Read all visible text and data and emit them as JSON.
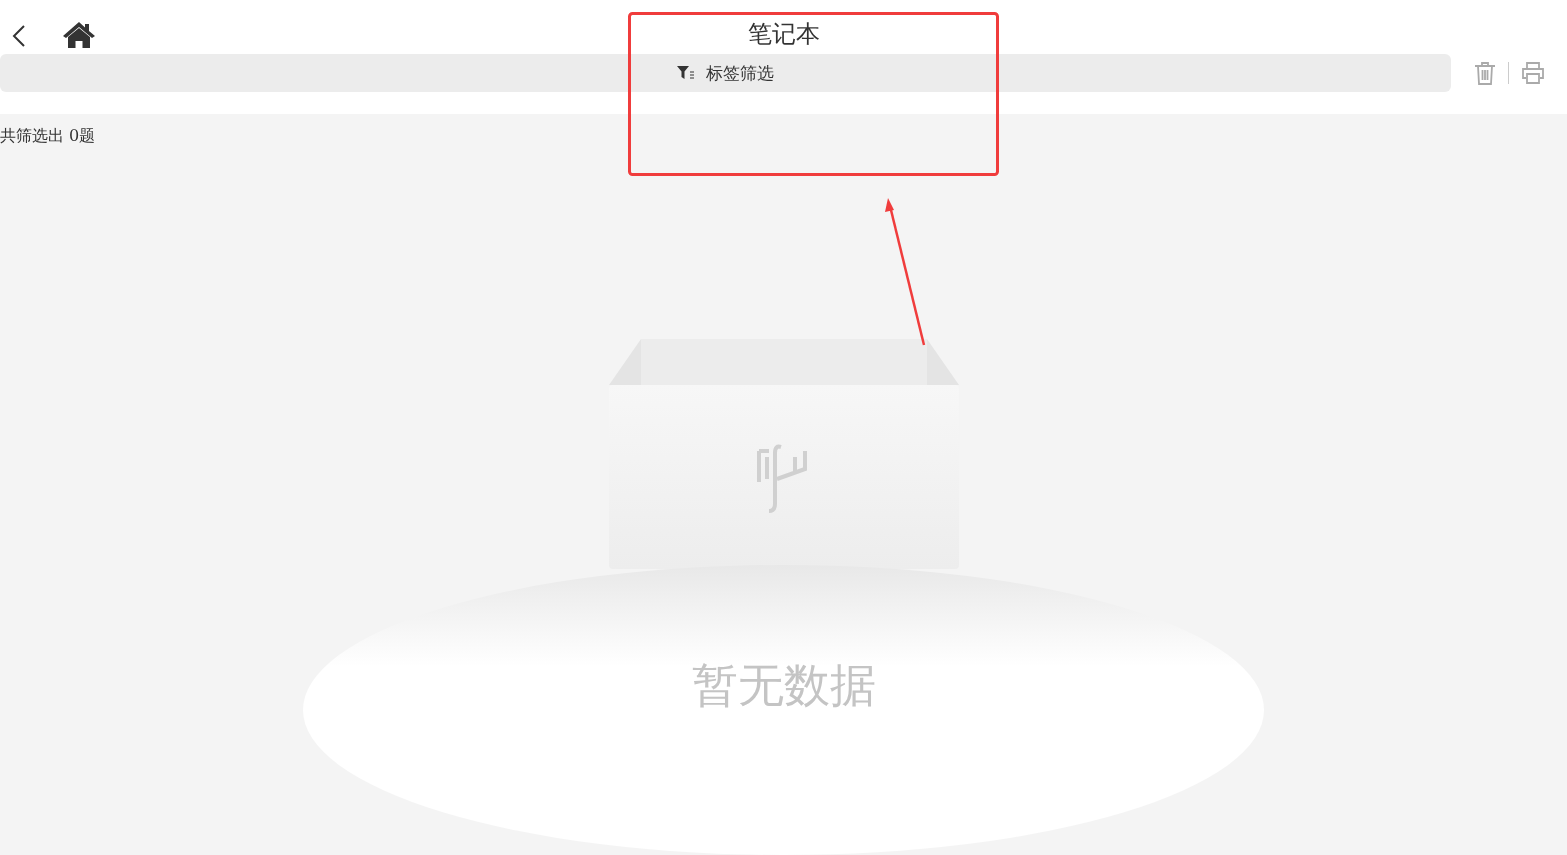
{
  "header": {
    "title": "笔记本"
  },
  "filter_bar": {
    "label": "标签筛选"
  },
  "result_count": "共筛选出 0题",
  "empty_state": {
    "text": "暂无数据"
  }
}
